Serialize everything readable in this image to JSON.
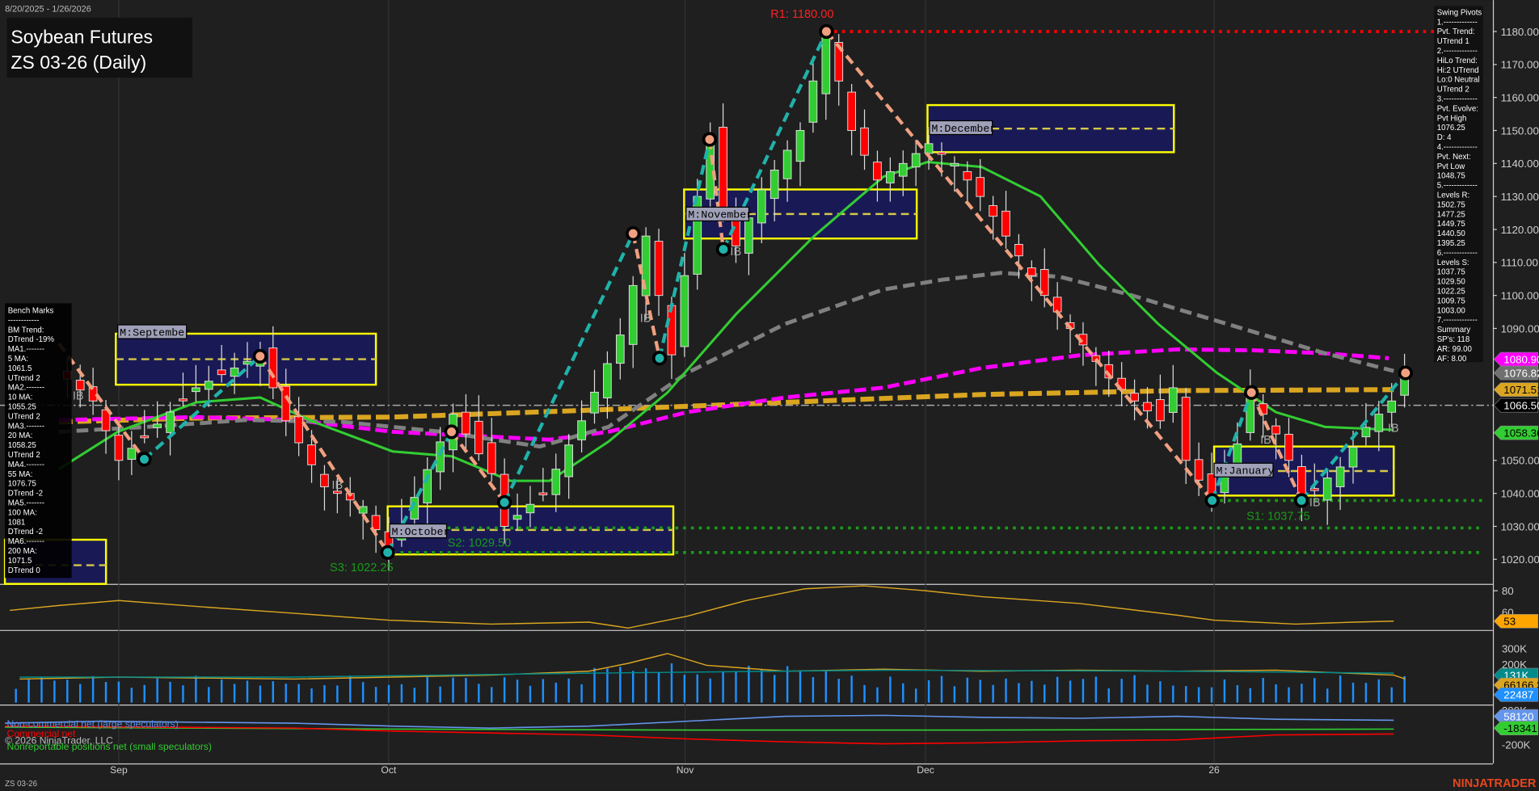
{
  "header": {
    "date_range": "8/20/2025 - 1/26/2026",
    "title_line1": "Soybean Futures",
    "title_line2": "ZS 03-26 (Daily)"
  },
  "benchmarks": {
    "lines": [
      "Bench Marks",
      "------------",
      "BM Trend:",
      "DTrend -19%",
      "MA1.-------",
      "5 MA:",
      "1061.5",
      "UTrend 2",
      "MA2.-------",
      "10 MA:",
      "1055.25",
      "UTrend 2",
      "MA3.-------",
      "20 MA:",
      "1058.25",
      "UTrend 2",
      "MA4.-------",
      "55 MA:",
      "1076.75",
      "DTrend -2",
      "MA5.-------",
      "100 MA:",
      "1081",
      "DTrend -2",
      "MA6.-------",
      "200 MA:",
      "1071.5",
      "DTrend 0"
    ]
  },
  "swing_pivots": {
    "lines": [
      "Swing Pivots",
      "1.-------------",
      "Pvt. Trend:",
      "UTrend 1",
      "2.-------------",
      "HiLo Trend:",
      "Hi:2 UTrend",
      "Lo:0 Neutral",
      "UTrend 2",
      "3.-------------",
      "Pvt. Evolve:",
      "Pvt High",
      "1076.25",
      "D: 4",
      "4.-------------",
      "Pvt. Next:",
      "Pvt Low",
      "1048.75",
      "5.-------------",
      "Levels R:",
      "1502.75",
      "1477.25",
      "1449.75",
      "1440.50",
      "1395.25",
      "6.-------------",
      "Levels S:",
      "1037.75",
      "1029.50",
      "1022.25",
      "1009.75",
      "1003.00",
      "7.-------------",
      "Summary",
      "SP's: 118",
      "AR: 99.00",
      "AF: 8.00"
    ]
  },
  "levels": {
    "r1": "R1: 1180.00",
    "s1": "S1: 1037.75",
    "s2": "S2: 1029.50",
    "s3": "S3: 1022.25"
  },
  "month_boxes": [
    "M:September",
    "M:October",
    "M:November",
    "M:December",
    "M:January"
  ],
  "price_axis": [
    "1180.00",
    "1170.00",
    "1160.00",
    "1150.00",
    "1140.00",
    "1130.00",
    "1120.00",
    "1110.00",
    "1100.00",
    "1090.00",
    "1050.00",
    "1040.00",
    "1030.00",
    "1020.00"
  ],
  "price_badges": [
    {
      "label": "1080.90",
      "color": "#ff00ff",
      "text": "#ffffff"
    },
    {
      "label": "1076.82",
      "color": "#707070",
      "text": "#ffffff"
    },
    {
      "label": "1071.51",
      "color": "#daa520",
      "text": "#000000"
    },
    {
      "label": "1066.50",
      "color": "#000000",
      "text": "#ffffff"
    },
    {
      "label": "1058.36",
      "color": "#32cd32",
      "text": "#000000"
    }
  ],
  "oscillator": {
    "axis": [
      "80",
      "60"
    ],
    "badge": "53"
  },
  "volume": {
    "axis": [
      "300K",
      "200K"
    ],
    "badges": [
      {
        "label": "131K",
        "color": "#008b8b",
        "text": "#ffffff"
      },
      {
        "label": "66166.32",
        "color": "#daa520",
        "text": "#000000"
      },
      {
        "label": "22487",
        "color": "#1e90ff",
        "text": "#ffffff"
      }
    ]
  },
  "cot": {
    "axis": [
      "200K",
      "-200K"
    ],
    "badges": [
      {
        "label": "58120",
        "color": "#6495ed",
        "text": "#ffffff"
      },
      {
        "label": "-18341",
        "color": "#32cd32",
        "text": "#000000"
      }
    ],
    "legend": [
      "Non-commercial net (large speculators)",
      "Commercial net",
      "Nonreportable positions net (small speculators)"
    ]
  },
  "copyright": "© 2026 NinjaTrader, LLC",
  "date_axis": [
    "Sep",
    "Oct",
    "Nov",
    "Dec",
    "26"
  ],
  "footer": {
    "instrument": "ZS 03-26",
    "brand": "NINJATRADER"
  },
  "ib_label": "IB",
  "chart_data": {
    "type": "candlestick",
    "x_start": "2025-08-20",
    "x_end": "2026-01-26",
    "ylim": [
      1015,
      1185
    ],
    "pivot_closes": [
      [
        0,
        1062
      ],
      [
        3,
        1078
      ],
      [
        6,
        1068
      ],
      [
        8,
        1050
      ],
      [
        14,
        1072
      ],
      [
        19,
        1082
      ],
      [
        21,
        1062
      ],
      [
        24,
        1042
      ],
      [
        27,
        1036
      ],
      [
        29,
        1022
      ],
      [
        34,
        1064
      ],
      [
        37,
        1046
      ],
      [
        38,
        1030
      ],
      [
        41,
        1040
      ],
      [
        44,
        1062
      ],
      [
        47,
        1088
      ],
      [
        49,
        1118
      ],
      [
        50,
        1100
      ],
      [
        51,
        1082
      ],
      [
        53,
        1130
      ],
      [
        54,
        1148
      ],
      [
        55,
        1125
      ],
      [
        56,
        1115
      ],
      [
        58,
        1132
      ],
      [
        61,
        1150
      ],
      [
        63,
        1180
      ],
      [
        65,
        1150
      ],
      [
        67,
        1135
      ],
      [
        69,
        1140
      ],
      [
        71,
        1146
      ],
      [
        73,
        1140
      ],
      [
        75,
        1130
      ],
      [
        78,
        1112
      ],
      [
        80,
        1100
      ],
      [
        82,
        1090
      ],
      [
        85,
        1075
      ],
      [
        87,
        1068
      ],
      [
        89,
        1062
      ],
      [
        90,
        1072
      ],
      [
        91,
        1050
      ],
      [
        93,
        1038
      ],
      [
        95,
        1055
      ],
      [
        96,
        1070
      ],
      [
        98,
        1058
      ],
      [
        99,
        1050
      ],
      [
        100,
        1038
      ],
      [
        103,
        1048
      ],
      [
        105,
        1060
      ],
      [
        107,
        1068
      ],
      [
        108,
        1076
      ]
    ]
  }
}
